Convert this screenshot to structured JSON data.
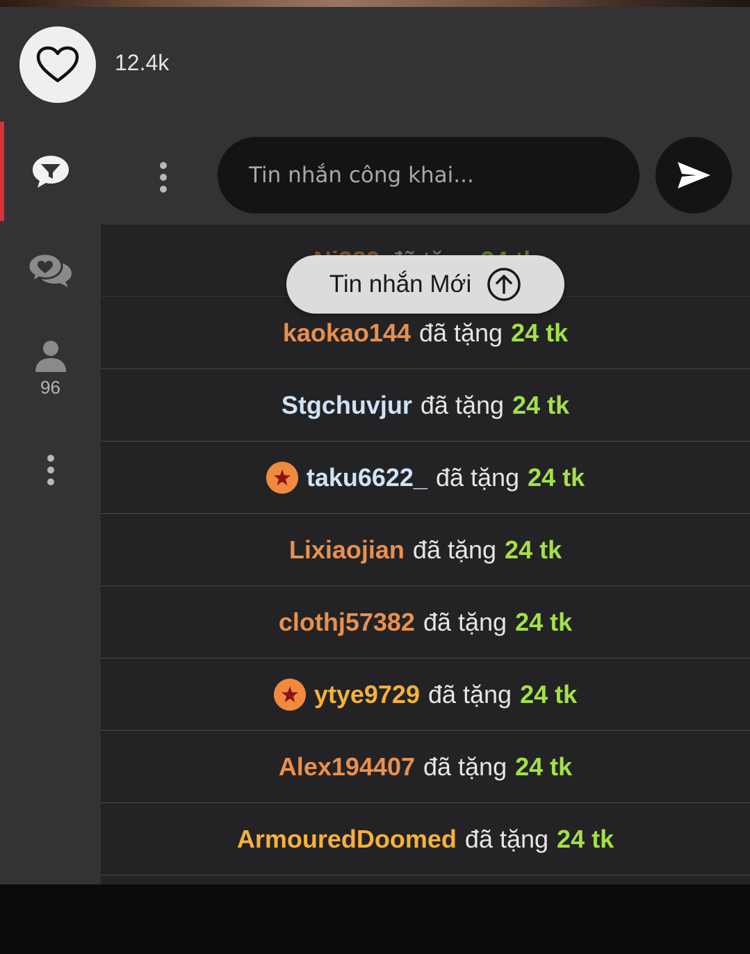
{
  "likes": {
    "count": "12.4k"
  },
  "sidebar": {
    "viewer_count": "96"
  },
  "chat_input": {
    "placeholder": "Tin nhắn công khai..."
  },
  "new_message_button": {
    "label": "Tin nhắn Mới"
  },
  "colors": {
    "accent": "#d8323a",
    "gift_amount": "#a3e047",
    "badge": "#f08a3e"
  },
  "messages": [
    {
      "user": "Ni389",
      "user_color": "#e8904e",
      "action": "đã tặng",
      "amount": "24 tk",
      "badge": false
    },
    {
      "user": "kaokao144",
      "user_color": "#e8904e",
      "action": "đã tặng",
      "amount": "24 tk",
      "badge": false
    },
    {
      "user": "Stgchuvjur",
      "user_color": "#cfe3f7",
      "action": "đã tặng",
      "amount": "24 tk",
      "badge": false
    },
    {
      "user": "taku6622_",
      "user_color": "#cfe3f7",
      "action": "đã tặng",
      "amount": "24 tk",
      "badge": true
    },
    {
      "user": "Lixiaojian",
      "user_color": "#e8904e",
      "action": "đã tặng",
      "amount": "24 tk",
      "badge": false
    },
    {
      "user": "clothj57382",
      "user_color": "#e8904e",
      "action": "đã tặng",
      "amount": "24 tk",
      "badge": false
    },
    {
      "user": "ytye9729",
      "user_color": "#f5b13a",
      "action": "đã tặng",
      "amount": "24 tk",
      "badge": true
    },
    {
      "user": "Alex194407",
      "user_color": "#e8904e",
      "action": "đã tặng",
      "amount": "24 tk",
      "badge": false
    },
    {
      "user": "ArmouredDoomed",
      "user_color": "#f5b13a",
      "action": "đã tặng",
      "amount": "24 tk",
      "badge": false
    }
  ]
}
